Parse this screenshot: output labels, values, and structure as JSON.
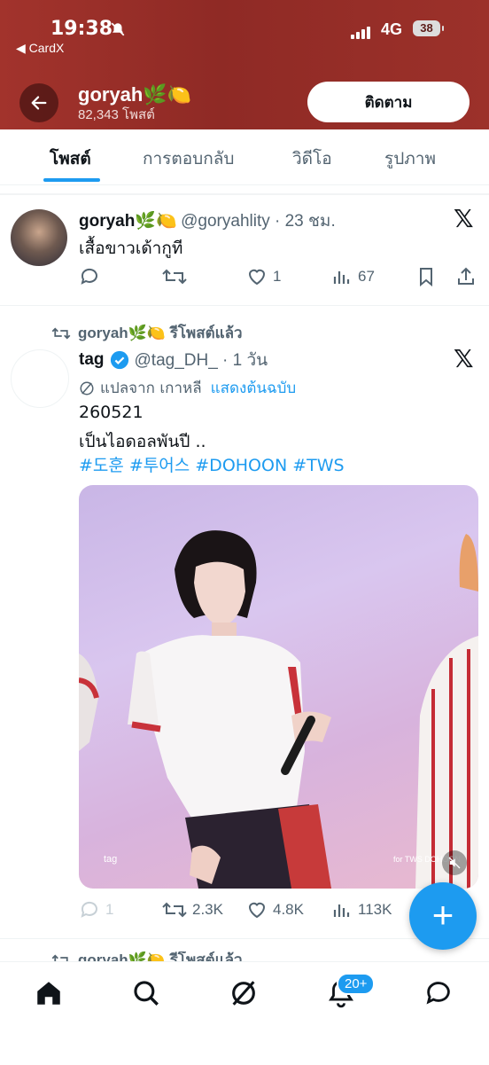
{
  "status_bar": {
    "time": "19:38",
    "back_app": "◀ CardX",
    "network": "4G",
    "battery": "38"
  },
  "header": {
    "name": "goryah🌿🍋",
    "post_count": "82,343 โพสต์",
    "follow_label": "ติดตาม"
  },
  "tabs": [
    {
      "label": "โพสต์",
      "active": true
    },
    {
      "label": "การตอบกลับ",
      "active": false
    },
    {
      "label": "วิดีโอ",
      "active": false
    },
    {
      "label": "รูปภาพ",
      "active": false
    }
  ],
  "tweet1": {
    "name": "goryah🌿🍋",
    "handle": "@goryahlity · 23 ชม.",
    "text": "เสื้อขาวเด้ากูที",
    "likes": "1",
    "views": "67"
  },
  "tweet2": {
    "repost_label": "goryah🌿🍋 รีโพสต์แล้ว",
    "name": "tag",
    "handle": "@tag_DH_ · 1 วัน",
    "translated_from": "แปลจาก เกาหลี",
    "show_original": "แสดงต้นฉบับ",
    "line1": "260521",
    "line2": "เป็นไอดอลพันปี ..",
    "hashtags": [
      "#도훈",
      "#투어스",
      "#DOHOON",
      "#TWS"
    ],
    "replies": "1",
    "reposts": "2.3K",
    "likes": "4.8K",
    "views": "113K",
    "media_watermark_left": "tag",
    "media_watermark_right": "for TWS DOHOON"
  },
  "tweet3": {
    "repost_label": "goryah🌿🍋 รีโพสต์แล้ว"
  },
  "notifications_badge": "20+",
  "colors": {
    "accent": "#1d9bf0",
    "header_bg": "#9c312a",
    "text_primary": "#0f1419",
    "text_secondary": "#536471"
  }
}
